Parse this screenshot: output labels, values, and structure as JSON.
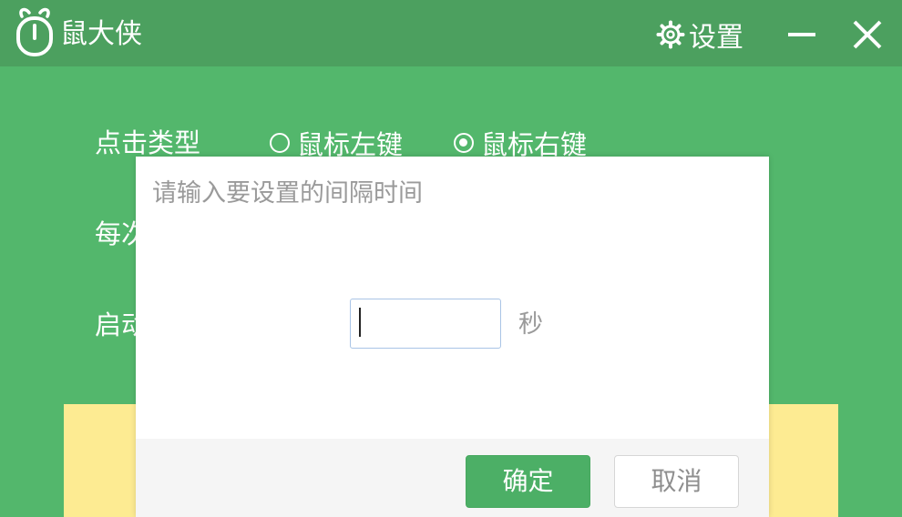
{
  "app": {
    "title": "鼠大侠",
    "logo_icon": "mouse-icon",
    "settings_label": "设置",
    "settings_icon": "gear-icon",
    "minimize_icon": "minimize-icon",
    "close_icon": "close-icon"
  },
  "form": {
    "click_type_label": "点击类型",
    "click_type_options": [
      {
        "label": "鼠标左键",
        "checked": false
      },
      {
        "label": "鼠标右键",
        "checked": true
      }
    ],
    "partial_row_2_label": "每次",
    "partial_row_3_label": "启动"
  },
  "dialog": {
    "title": "请输入要设置的间隔时间",
    "input_value": "",
    "unit": "秒",
    "ok_label": "确定",
    "cancel_label": "取消"
  },
  "colors": {
    "background": "#53b76c",
    "titlebar": "#4ca05f",
    "panel": "#fdeb92",
    "ok_button": "#4caf66"
  }
}
